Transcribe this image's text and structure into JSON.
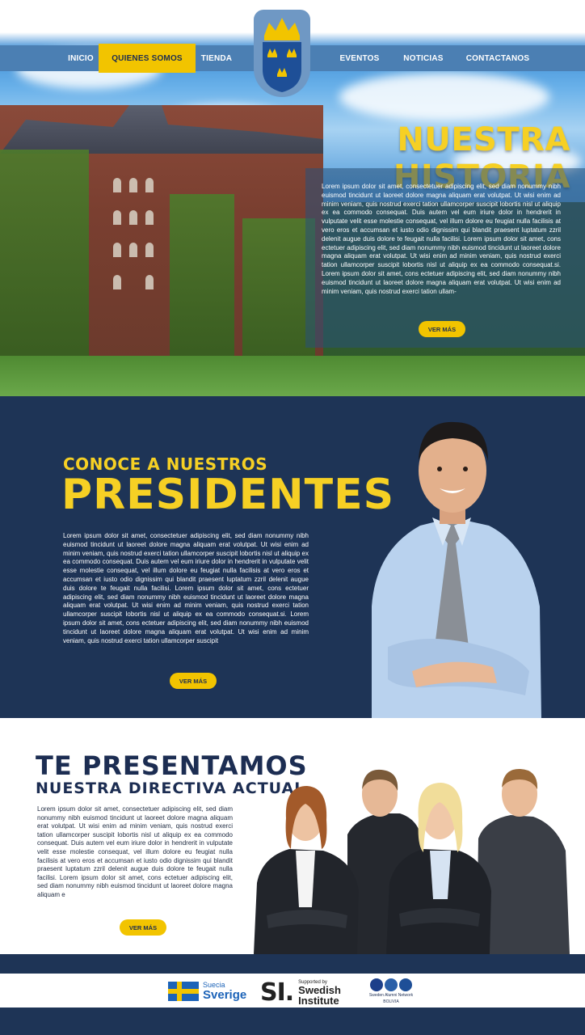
{
  "nav": {
    "left_items": [
      {
        "label": "INICIO"
      },
      {
        "label": "QUIENES SOMOS"
      },
      {
        "label": "TIENDA"
      }
    ],
    "right_items": [
      {
        "label": "EVENTOS"
      },
      {
        "label": "NOTICIAS"
      },
      {
        "label": "CONTACTANOS"
      }
    ],
    "active": "QUIENES SOMOS"
  },
  "hero": {
    "title": "NUESTRA HISTORIA",
    "text": "Lorem ipsum dolor sit amet, consectetuer adipiscing elit, sed diam nonummy nibh euismod tincidunt ut laoreet dolore magna aliquam erat volutpat. Ut wisi enim ad minim veniam, quis nostrud exerci tation ullamcorper suscipit lobortis nisl ut aliquip ex ea commodo consequat. Duis autem vel eum iriure dolor in hendrerit in vulputate velit esse molestie consequat, vel illum dolore eu feugiat nulla facilisis at vero eros et accumsan et iusto odio dignissim qui blandit praesent luptatum zzril delenit augue duis dolore te feugait nulla facilisi. Lorem ipsum dolor sit amet, cons ectetuer adipiscing elit, sed diam nonummy nibh euismod tincidunt ut laoreet dolore magna aliquam erat volutpat. Ut wisi enim ad minim veniam, quis nostrud exerci tation ullamcorper suscipit lobortis nisl ut aliquip ex ea commodo consequat.si. Lorem ipsum dolor sit amet, cons ectetuer adipiscing elit, sed diam nonummy nibh euismod tincidunt ut laoreet dolore magna aliquam erat volutpat. Ut wisi enim ad minim veniam, quis nostrud exerci tation ullam-",
    "button": "VER MÁS"
  },
  "presidents": {
    "subtitle": "CONOCE A NUESTROS",
    "title": "PRESIDENTES",
    "text": "Lorem ipsum dolor sit amet, consectetuer adipiscing elit, sed diam nonummy nibh euismod tincidunt ut laoreet dolore magna aliquam erat volutpat. Ut wisi enim ad minim veniam, quis nostrud exerci tation ullamcorper suscipit lobortis nisl ut aliquip ex ea commodo consequat. Duis autem vel eum iriure dolor in hendrerit in vulputate velit esse molestie consequat, vel illum dolore eu feugiat nulla facilisis at vero eros et accumsan et iusto odio dignissim qui blandit praesent luptatum zzril delenit augue duis dolore te feugait nulla facilisi. Lorem ipsum dolor sit amet, cons ectetuer adipiscing elit, sed diam nonummy nibh euismod tincidunt ut laoreet dolore magna aliquam erat volutpat. Ut wisi enim ad minim veniam, quis nostrud exerci tation ullamcorper suscipit lobortis nisl ut aliquip ex ea commodo consequat.si. Lorem ipsum dolor sit amet, cons ectetuer adipiscing elit, sed diam nonummy nibh euismod tincidunt ut laoreet dolore magna aliquam erat volutpat. Ut wisi enim ad minim veniam, quis nostrud exerci tation ullamcorper suscipit",
    "button": "VER MÁS"
  },
  "directiva": {
    "title": "TE PRESENTAMOS",
    "subtitle": "NUESTRA DIRECTIVA ACTUAL",
    "text": "Lorem ipsum dolor sit amet, consectetuer adipiscing elit, sed diam nonummy nibh euismod tincidunt ut laoreet dolore magna aliquam erat volutpat. Ut wisi enim ad minim veniam, quis nostrud exerci tation ullamcorper suscipit lobortis nisl ut aliquip ex ea commodo consequat. Duis autem vel eum iriure dolor in hendrerit in vulputate velit esse molestie consequat, vel illum dolore eu feugiat nulla facilisis at vero eros et accumsan et iusto odio dignissim qui blandit praesent luptatum zzril delenit augue duis dolore te feugait nulla facilisi. Lorem ipsum dolor sit amet, cons ectetuer adipiscing elit, sed diam nonummy nibh euismod tincidunt ut laoreet dolore magna aliquam e",
    "button": "VER MÁS"
  },
  "footer": {
    "sverige_small": "Suecia",
    "sverige_big": "Sverige",
    "si_mark": "SI.",
    "si_supported": "Supported by",
    "si_name1": "Swedish",
    "si_name2": "Institute",
    "alumni_line1": "Sweden Alumni Network",
    "alumni_line2": "BOLIVIA"
  },
  "colors": {
    "navy": "#1e3456",
    "yellow": "#f6d024",
    "nav_blue": "#4b7fb3",
    "button_yellow": "#f2c400"
  }
}
